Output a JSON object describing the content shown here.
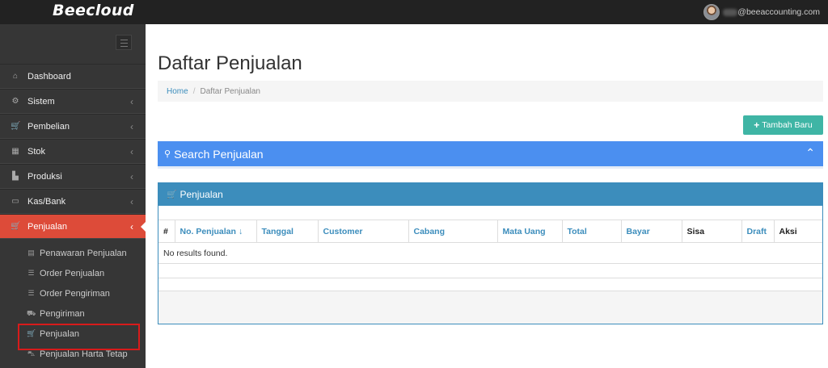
{
  "app": {
    "logo": "Beecloud"
  },
  "user": {
    "email": "@beeaccounting.com"
  },
  "sidebar": {
    "items": [
      {
        "label": "Dashboard",
        "icon": "home-icon",
        "glyph": "⌂",
        "chevron": ""
      },
      {
        "label": "Sistem",
        "icon": "cogs-icon",
        "glyph": "⚙",
        "chevron": "‹"
      },
      {
        "label": "Pembelian",
        "icon": "cart-icon",
        "glyph": "🛒",
        "chevron": "‹"
      },
      {
        "label": "Stok",
        "icon": "box-icon",
        "glyph": "▦",
        "chevron": "‹"
      },
      {
        "label": "Produksi",
        "icon": "factory-icon",
        "glyph": "▙",
        "chevron": "‹"
      },
      {
        "label": "Kas/Bank",
        "icon": "money-icon",
        "glyph": "▭",
        "chevron": "‹"
      },
      {
        "label": "Penjualan",
        "icon": "cart-icon",
        "glyph": "🛒",
        "chevron": "‹"
      }
    ],
    "subitems": [
      {
        "label": "Penawaran Penjualan",
        "icon": "card-icon",
        "glyph": "▤"
      },
      {
        "label": "Order Penjualan",
        "icon": "list-icon",
        "glyph": "☰"
      },
      {
        "label": "Order Pengiriman",
        "icon": "list-alt-icon",
        "glyph": "☰"
      },
      {
        "label": "Pengiriman",
        "icon": "truck-icon",
        "glyph": "⛟"
      },
      {
        "label": "Penjualan",
        "icon": "cart-icon",
        "glyph": "🛒"
      },
      {
        "label": "Penjualan Harta Tetap",
        "icon": "car-icon",
        "glyph": "⛍"
      }
    ]
  },
  "page": {
    "title": "Daftar Penjualan",
    "breadcrumb": {
      "home": "Home",
      "separator": "/",
      "current": "Daftar Penjualan"
    },
    "add_button": {
      "icon": "+",
      "label": "Tambah Baru"
    }
  },
  "search_panel": {
    "icon": "⚲",
    "title": "Search Penjualan",
    "caret": "⌃"
  },
  "panel": {
    "icon": "🛒",
    "title": "Penjualan"
  },
  "table": {
    "columns": [
      "#",
      "No. Penjualan",
      "Tanggal",
      "Customer",
      "Cabang",
      "Mata Uang",
      "Total",
      "Bayar",
      "Sisa",
      "Draft",
      "Aksi"
    ],
    "sort_icon": "↓",
    "empty_message": "No results found."
  },
  "colors": {
    "accent": "#3c8dbc",
    "active_menu": "#dd4b39",
    "add_button": "#3fb5a5",
    "search_panel": "#4b8ff0"
  }
}
